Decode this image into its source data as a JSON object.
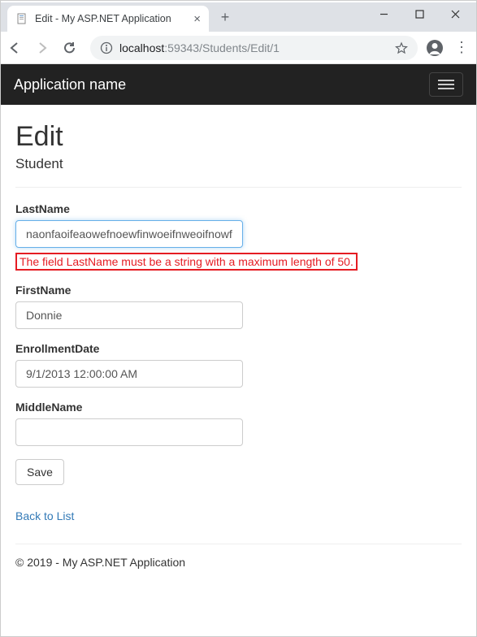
{
  "window": {
    "tab_title": "Edit - My ASP.NET Application",
    "url_host": "localhost",
    "url_port": ":59343",
    "url_path": "/Students/Edit/1"
  },
  "navbar": {
    "brand": "Application name"
  },
  "page": {
    "title": "Edit",
    "subtitle": "Student"
  },
  "form": {
    "lastname": {
      "label": "LastName",
      "value": "naonfaoifeaowefnoewfinwoeifnweoifnowf",
      "error": "The field LastName must be a string with a maximum length of 50."
    },
    "firstname": {
      "label": "FirstName",
      "value": "Donnie"
    },
    "enrollmentdate": {
      "label": "EnrollmentDate",
      "value": "9/1/2013 12:00:00 AM"
    },
    "middlename": {
      "label": "MiddleName",
      "value": ""
    },
    "save_button": "Save",
    "back_link": "Back to List"
  },
  "footer": {
    "text": "© 2019 - My ASP.NET Application"
  }
}
